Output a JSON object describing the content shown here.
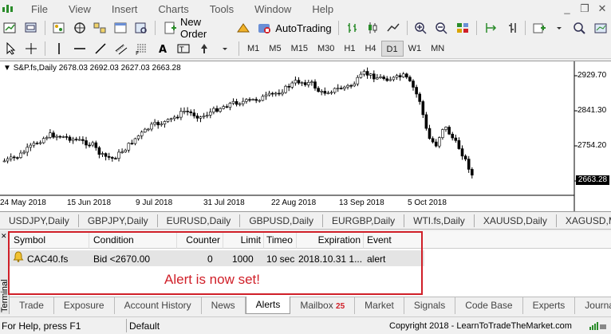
{
  "menu": {
    "items": [
      "File",
      "View",
      "Insert",
      "Charts",
      "Tools",
      "Window",
      "Help"
    ],
    "window_controls": [
      "_",
      "❐",
      "✕"
    ]
  },
  "toolbar": {
    "new_order_label": "New Order",
    "autotrading_label": "AutoTrading",
    "timeframes": [
      "M1",
      "M5",
      "M15",
      "M30",
      "H1",
      "H4",
      "D1",
      "W1",
      "MN"
    ],
    "active_timeframe": "D1"
  },
  "chart": {
    "header": "S&P.fs,Daily  2678.03 2692.03 2627.03 2663.28",
    "price_labels": [
      "2929.70",
      "2841.30",
      "2754.20"
    ],
    "last_price": "2663.28",
    "date_labels": [
      "24 May 2018",
      "15 Jun 2018",
      "9 Jul 2018",
      "31 Jul 2018",
      "22 Aug 2018",
      "13 Sep 2018",
      "5 Oct 2018"
    ],
    "bull_color": "#ffffff",
    "bear_color": "#000000"
  },
  "symbol_tabs": [
    "USDJPY,Daily",
    "GBPJPY,Daily",
    "EURUSD,Daily",
    "GBPUSD,Daily",
    "EURGBP,Daily",
    "WTI.fs,Daily",
    "XAUUSD,Daily",
    "XAGUSD,Mont"
  ],
  "terminal": {
    "side_label": "Terminal",
    "columns": [
      "Symbol",
      "Condition",
      "Counter",
      "Limit",
      "Timeo",
      "Expiration",
      "Event"
    ],
    "rows": [
      {
        "symbol": "CAC40.fs",
        "condition": "Bid <2670.00",
        "counter": "0",
        "limit": "1000",
        "timeout": "10 sec",
        "expiration": "2018.10.31 1...",
        "event": "alert"
      }
    ],
    "annotation": "Alert is now set!",
    "tabs": [
      "Trade",
      "Exposure",
      "Account History",
      "News",
      "Alerts",
      "Mailbox",
      "Market",
      "Signals",
      "Code Base",
      "Experts",
      "Journal"
    ],
    "active_tab": "Alerts",
    "mailbox_badge": "25",
    "accent_color": "#d01f28"
  },
  "status": {
    "help": "For Help, press F1",
    "profile": "Default",
    "copyright": "Copyright 2018 - LearnToTradeTheMarket.com"
  }
}
